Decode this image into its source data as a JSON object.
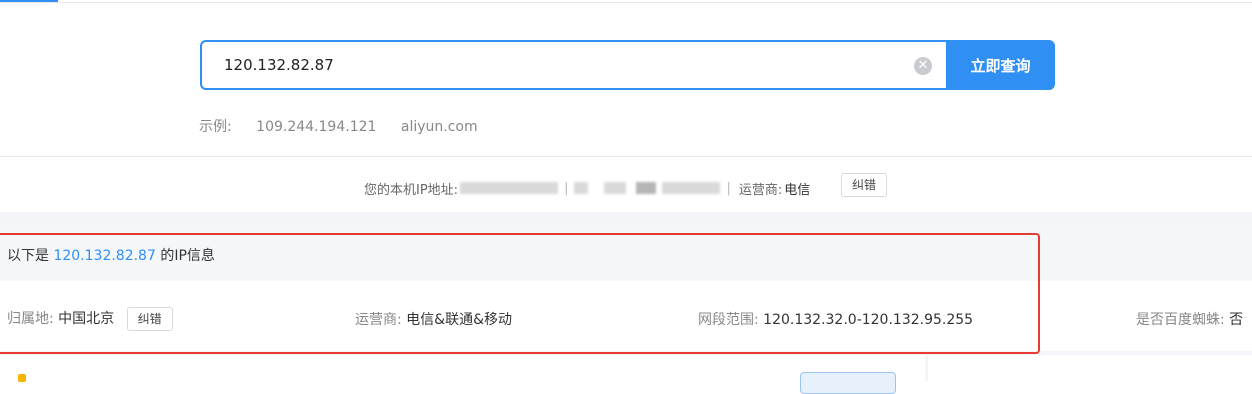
{
  "search": {
    "value": "120.132.82.87",
    "button_label": "立即查询"
  },
  "examples": {
    "label": "示例:",
    "items": [
      "109.244.194.121",
      "aliyun.com"
    ]
  },
  "local": {
    "label": "您的本机IP地址:",
    "isp_label": "运营商:",
    "isp_value": "电信",
    "report_label": "纠错"
  },
  "info": {
    "title_prefix": "以下是",
    "ip": "120.132.82.87",
    "title_suffix": "的IP信息",
    "location_label": "归属地:",
    "location_value": "中国北京",
    "location_report_label": "纠错",
    "isp_label": "运营商:",
    "isp_value": "电信&联通&移动",
    "range_label": "网段范围:",
    "range_value": "120.132.32.0-120.132.95.255",
    "spider_label": "是否百度蜘蛛:",
    "spider_value": "否"
  },
  "colors": {
    "accent": "#2f8ff2",
    "highlight_box": "#e83a35"
  }
}
